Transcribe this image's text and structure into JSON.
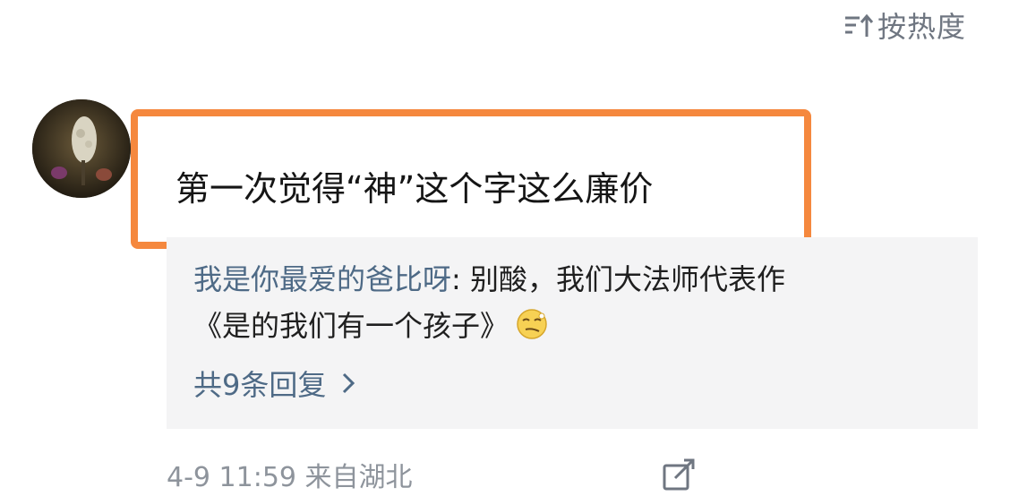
{
  "sort": {
    "label": "按热度",
    "icon": "sort-icon"
  },
  "comment": {
    "avatar": "avatar",
    "text": "第一次觉得“神”这个字这么廉价"
  },
  "reply": {
    "username": "我是你最爱的爸比呀",
    "separator": ": ",
    "text_line1": "别酸，我们大法师代表作",
    "text_line2": "《是的我们有一个孩子》",
    "emoji": "smirk-emoji-icon",
    "count_label": "共9条回复"
  },
  "meta": {
    "text": "4-9 11:59  来自湖北",
    "icon": "edit-icon"
  },
  "colors": {
    "highlight_border": "#f5883e",
    "link_blue": "#4e6a86",
    "reply_bg": "#f4f4f5",
    "meta_gray": "#8e949c"
  }
}
